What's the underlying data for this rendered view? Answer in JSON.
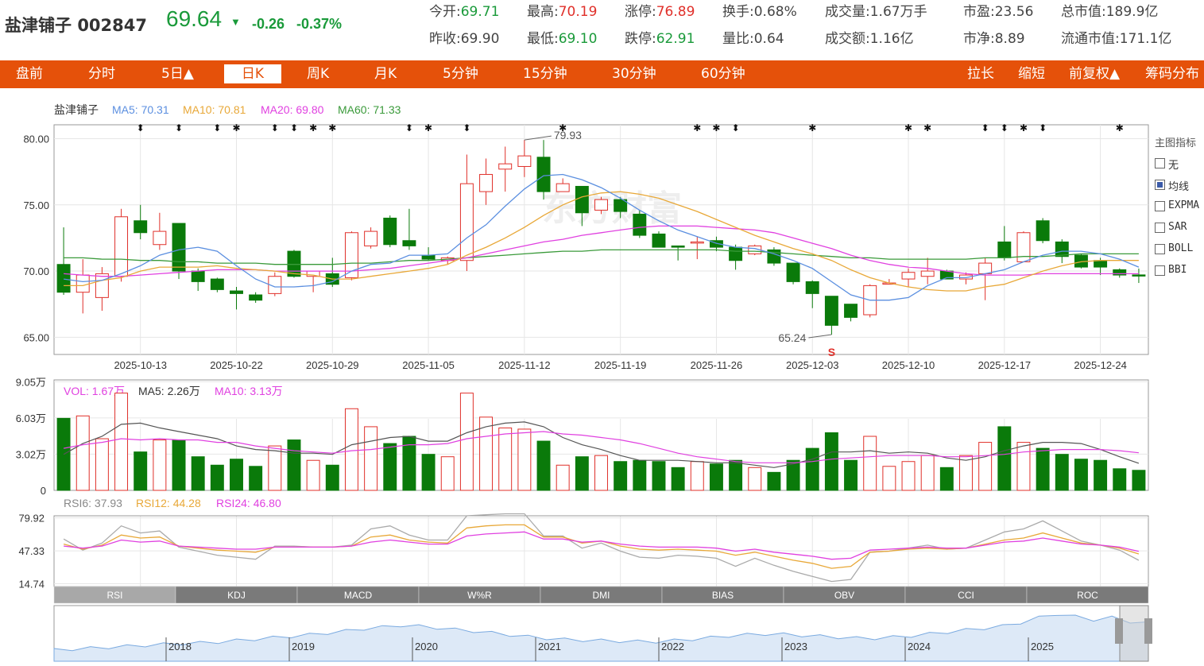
{
  "stock": {
    "name": "盐津铺子",
    "code": "002847",
    "price": "69.64",
    "arrow": "▼",
    "change": "-0.26",
    "change_pct": "-0.37%"
  },
  "quotes": [
    {
      "label": "今开:",
      "value": "69.71",
      "tone": "green"
    },
    {
      "label": "最高:",
      "value": "70.19",
      "tone": "red"
    },
    {
      "label": "涨停:",
      "value": "76.89",
      "tone": "red"
    },
    {
      "label": "换手:",
      "value": "0.68%",
      "tone": "black"
    },
    {
      "label": "成交量:",
      "value": "1.67万手",
      "tone": "black"
    },
    {
      "label": "市盈:",
      "value": "23.56",
      "tone": "black"
    },
    {
      "label": "总市值:",
      "value": "189.9亿",
      "tone": "black"
    },
    {
      "label": "昨收:",
      "value": "69.90",
      "tone": "black"
    },
    {
      "label": "最低:",
      "value": "69.10",
      "tone": "green"
    },
    {
      "label": "跌停:",
      "value": "62.91",
      "tone": "green"
    },
    {
      "label": "量比:",
      "value": "0.64",
      "tone": "black"
    },
    {
      "label": "成交额:",
      "value": "1.16亿",
      "tone": "black"
    },
    {
      "label": "市净:",
      "value": "8.89",
      "tone": "black"
    },
    {
      "label": "流通市值:",
      "value": "171.1亿",
      "tone": "black"
    }
  ],
  "nav": {
    "left": [
      "盘前",
      "分时",
      "5日▲",
      "日K",
      "周K",
      "月K",
      "5分钟",
      "15分钟",
      "30分钟",
      "60分钟"
    ],
    "active": "日K",
    "right": [
      "拉长",
      "缩短",
      "前复权▲",
      "筹码分布"
    ]
  },
  "colors": {
    "up": "#e0302a",
    "down": "#0a7a0a",
    "ma5": "#5b8fe0",
    "ma10": "#e8a838",
    "ma20": "#e040e0",
    "ma60": "#3a9a3a",
    "nav_bg": "#e5510a"
  },
  "kline": {
    "legend": {
      "name": "盐津铺子",
      "ma5": "MA5: 70.31",
      "ma10": "MA10: 70.81",
      "ma20": "MA20: 69.80",
      "ma60": "MA60: 71.33"
    },
    "y_ticks": [
      "80.00",
      "75.00",
      "70.00",
      "65.00"
    ],
    "y_values": [
      80,
      75,
      70,
      65
    ],
    "dates": [
      "2025-10-13",
      "2025-10-22",
      "2025-10-29",
      "2025-11-05",
      "2025-11-12",
      "2025-11-19",
      "2025-11-26",
      "2025-12-03",
      "2025-12-10",
      "2025-12-17",
      "2025-12-24"
    ],
    "high_note": "79.93",
    "low_note": "65.24",
    "low_marker": "S",
    "candles": [
      [
        70.5,
        68.4,
        73.3,
        68.2
      ],
      [
        68.4,
        69.7,
        70.9,
        66.8
      ],
      [
        68.0,
        69.8,
        70.3,
        67.0
      ],
      [
        69.6,
        74.1,
        74.7,
        69.2
      ],
      [
        73.8,
        72.9,
        75.0,
        72.4
      ],
      [
        72.0,
        73.0,
        74.4,
        71.6
      ],
      [
        73.6,
        70.0,
        73.6,
        69.4
      ],
      [
        70.0,
        69.2,
        70.2,
        68.5
      ],
      [
        69.4,
        68.6,
        69.5,
        68.4
      ],
      [
        68.5,
        68.3,
        68.8,
        67.1
      ],
      [
        68.2,
        67.8,
        68.4,
        67.6
      ],
      [
        68.3,
        69.6,
        69.9,
        68.1
      ],
      [
        71.5,
        69.6,
        71.6,
        69.5
      ],
      [
        69.6,
        70.0,
        70.0,
        68.4
      ],
      [
        69.8,
        69.0,
        71.0,
        68.8
      ],
      [
        69.5,
        72.9,
        73.0,
        69.3
      ],
      [
        71.9,
        73.0,
        73.3,
        71.7
      ],
      [
        74.0,
        72.0,
        74.2,
        71.8
      ],
      [
        72.3,
        71.9,
        74.7,
        71.6
      ],
      [
        71.2,
        70.9,
        71.8,
        70.8
      ],
      [
        70.8,
        71.0,
        71.1,
        70.5
      ],
      [
        70.8,
        76.6,
        78.8,
        70.0
      ],
      [
        76.0,
        77.3,
        78.5,
        75.0
      ],
      [
        77.7,
        78.1,
        79.4,
        76.0
      ],
      [
        77.9,
        78.7,
        79.9,
        77.1
      ],
      [
        78.6,
        76.0,
        79.9,
        75.4
      ],
      [
        76.0,
        76.6,
        77.0,
        76.0
      ],
      [
        76.4,
        74.4,
        76.4,
        73.4
      ],
      [
        74.6,
        75.4,
        75.6,
        74.3
      ],
      [
        75.4,
        74.5,
        75.6,
        74.0
      ],
      [
        74.3,
        72.7,
        74.6,
        72.5
      ],
      [
        72.8,
        71.8,
        73.0,
        71.8
      ],
      [
        71.9,
        71.8,
        71.9,
        70.8
      ],
      [
        72.2,
        72.2,
        72.6,
        70.9
      ],
      [
        72.3,
        71.8,
        72.6,
        71.5
      ],
      [
        71.8,
        70.8,
        72.0,
        70.1
      ],
      [
        71.3,
        71.9,
        72.0,
        71.2
      ],
      [
        71.6,
        70.6,
        71.8,
        70.4
      ],
      [
        70.6,
        69.2,
        70.6,
        69.0
      ],
      [
        69.2,
        68.3,
        69.3,
        67.2
      ],
      [
        68.1,
        65.9,
        68.1,
        65.2
      ],
      [
        67.5,
        66.5,
        67.5,
        66.2
      ],
      [
        66.7,
        68.9,
        69.0,
        66.5
      ],
      [
        69.1,
        69.1,
        69.4,
        69.0
      ],
      [
        69.4,
        69.9,
        70.2,
        68.8
      ],
      [
        69.6,
        70.0,
        71.0,
        69.0
      ],
      [
        70.0,
        69.4,
        70.1,
        69.4
      ],
      [
        69.4,
        69.7,
        69.9,
        69.0
      ],
      [
        69.8,
        70.6,
        71.0,
        67.8
      ],
      [
        72.2,
        71.0,
        73.4,
        70.8
      ],
      [
        70.7,
        72.9,
        73.0,
        70.9
      ],
      [
        73.8,
        72.3,
        74.0,
        72.1
      ],
      [
        72.2,
        71.1,
        72.4,
        70.6
      ],
      [
        71.2,
        70.3,
        71.3,
        70.2
      ],
      [
        70.8,
        70.3,
        71.0,
        69.7
      ],
      [
        70.1,
        69.7,
        70.2,
        69.5
      ],
      [
        69.71,
        69.64,
        70.19,
        69.1
      ]
    ],
    "ma5": [
      69.4,
      69.2,
      69.3,
      69.8,
      70.4,
      71.2,
      71.6,
      71.8,
      71.5,
      70.4,
      69.4,
      68.8,
      68.8,
      68.9,
      69.2,
      70.0,
      70.5,
      70.6,
      71.2,
      71.2,
      71.3,
      72.5,
      73.5,
      74.9,
      76.2,
      77.2,
      77.3,
      76.9,
      76.3,
      75.5,
      74.6,
      73.8,
      73.1,
      72.6,
      72.1,
      71.8,
      71.7,
      71.3,
      70.8,
      70.2,
      69.2,
      68.2,
      67.8,
      67.8,
      68.0,
      68.9,
      69.5,
      69.5,
      69.8,
      70.1,
      70.7,
      71.2,
      71.5,
      71.5,
      71.3,
      70.9,
      70.3
    ],
    "ma10": [
      68.9,
      68.9,
      69.3,
      69.5,
      70.0,
      70.3,
      70.3,
      70.3,
      70.4,
      70.2,
      70.1,
      70.0,
      69.8,
      69.7,
      69.4,
      69.4,
      69.6,
      69.8,
      70.0,
      70.2,
      70.5,
      71.2,
      71.8,
      72.5,
      73.3,
      74.2,
      75.0,
      75.6,
      75.9,
      76.0,
      75.8,
      75.5,
      75.0,
      74.5,
      73.9,
      73.3,
      72.7,
      72.2,
      71.7,
      71.3,
      70.8,
      70.1,
      69.5,
      69.1,
      68.8,
      68.6,
      68.5,
      68.5,
      68.8,
      69.0,
      69.5,
      70.0,
      70.4,
      70.7,
      70.8,
      70.8,
      70.8
    ],
    "ma20": [
      69.8,
      69.7,
      69.6,
      69.6,
      69.7,
      69.8,
      69.9,
      70.0,
      70.1,
      70.1,
      70.1,
      70.0,
      70.0,
      70.0,
      70.0,
      70.0,
      70.1,
      70.2,
      70.4,
      70.6,
      70.8,
      71.0,
      71.3,
      71.6,
      71.9,
      72.2,
      72.4,
      72.7,
      72.9,
      73.1,
      73.3,
      73.4,
      73.4,
      73.4,
      73.3,
      73.2,
      73.1,
      72.9,
      72.5,
      72.1,
      71.7,
      71.2,
      70.8,
      70.5,
      70.3,
      70.2,
      70.0,
      69.8,
      69.7,
      69.7,
      69.7,
      69.8,
      69.8,
      69.8,
      69.8,
      69.8,
      69.8
    ],
    "ma60": [
      71.0,
      71.0,
      70.9,
      70.9,
      70.8,
      70.8,
      70.7,
      70.7,
      70.6,
      70.6,
      70.6,
      70.5,
      70.5,
      70.5,
      70.5,
      70.6,
      70.6,
      70.7,
      70.8,
      70.8,
      70.9,
      71.0,
      71.1,
      71.2,
      71.3,
      71.4,
      71.5,
      71.5,
      71.6,
      71.6,
      71.6,
      71.6,
      71.6,
      71.6,
      71.6,
      71.5,
      71.5,
      71.4,
      71.3,
      71.2,
      71.1,
      71.0,
      71.0,
      70.9,
      70.9,
      70.9,
      70.9,
      70.9,
      71.0,
      71.0,
      71.1,
      71.1,
      71.2,
      71.3,
      71.3,
      71.3,
      71.3
    ],
    "event_markers": [
      {
        "index": 4,
        "symbol": "⬍"
      },
      {
        "index": 6,
        "symbol": "⬍"
      },
      {
        "index": 8,
        "symbol": "⬍"
      },
      {
        "index": 9,
        "symbol": "✱"
      },
      {
        "index": 11,
        "symbol": "⬍"
      },
      {
        "index": 12,
        "symbol": "⬍"
      },
      {
        "index": 13,
        "symbol": "✱"
      },
      {
        "index": 14,
        "symbol": "✱"
      },
      {
        "index": 18,
        "symbol": "⬍"
      },
      {
        "index": 19,
        "symbol": "✱"
      },
      {
        "index": 21,
        "symbol": "⬍"
      },
      {
        "index": 26,
        "symbol": "✱"
      },
      {
        "index": 33,
        "symbol": "✱"
      },
      {
        "index": 34,
        "symbol": "✱"
      },
      {
        "index": 35,
        "symbol": "⬍"
      },
      {
        "index": 39,
        "symbol": "✱"
      },
      {
        "index": 44,
        "symbol": "✱"
      },
      {
        "index": 45,
        "symbol": "✱"
      },
      {
        "index": 48,
        "symbol": "⬍"
      },
      {
        "index": 49,
        "symbol": "⬍"
      },
      {
        "index": 50,
        "symbol": "✱"
      },
      {
        "index": 51,
        "symbol": "⬍"
      },
      {
        "index": 55,
        "symbol": "✱"
      }
    ],
    "watermark": "东方财富"
  },
  "indicators_panel": {
    "title": "主图指标",
    "options": [
      {
        "label": "无",
        "checked": false
      },
      {
        "label": "均线",
        "checked": true
      },
      {
        "label": "EXPMA",
        "checked": false
      },
      {
        "label": "SAR",
        "checked": false
      },
      {
        "label": "BOLL",
        "checked": false
      },
      {
        "label": "BBI",
        "checked": false
      }
    ]
  },
  "volume": {
    "legend": {
      "vol": "VOL: 1.67万",
      "ma5": "MA5: 2.26万",
      "ma10": "MA10: 3.13万"
    },
    "y_ticks": [
      "9.05万",
      "6.03万",
      "3.02万",
      "0"
    ],
    "y_values": [
      9.05,
      6.03,
      3.02,
      0
    ],
    "bars": [
      6.0,
      6.2,
      4.3,
      8.1,
      3.2,
      4.2,
      4.2,
      2.8,
      2.1,
      2.6,
      2.0,
      3.7,
      4.2,
      2.5,
      2.1,
      6.8,
      5.3,
      3.9,
      4.5,
      3.0,
      2.8,
      8.1,
      6.1,
      5.2,
      5.1,
      4.1,
      2.1,
      2.8,
      2.9,
      2.4,
      2.5,
      2.4,
      1.9,
      2.4,
      2.2,
      2.5,
      1.9,
      1.5,
      2.5,
      3.5,
      4.8,
      2.5,
      4.5,
      2.0,
      2.4,
      2.9,
      1.9,
      2.9,
      4.0,
      5.3,
      4.0,
      3.5,
      3.0,
      2.6,
      2.5,
      1.8,
      1.67
    ],
    "ma5": [
      3.0,
      3.9,
      4.5,
      5.5,
      5.6,
      5.2,
      4.9,
      4.6,
      4.3,
      3.7,
      3.4,
      3.3,
      3.1,
      3.1,
      3.0,
      3.8,
      4.1,
      4.4,
      4.5,
      4.1,
      4.1,
      4.8,
      5.3,
      5.6,
      5.7,
      5.3,
      4.4,
      3.8,
      3.4,
      2.9,
      2.5,
      2.5,
      2.5,
      2.4,
      2.3,
      2.3,
      2.1,
      1.9,
      2.2,
      2.6,
      3.2,
      3.2,
      3.3,
      3.1,
      3.2,
      3.1,
      2.7,
      2.5,
      2.8,
      3.3,
      3.7,
      4.0,
      4.0,
      3.9,
      3.4,
      2.8,
      2.26
    ],
    "ma10": [
      3.5,
      3.8,
      4.0,
      4.3,
      4.2,
      4.3,
      4.2,
      4.2,
      4.0,
      4.0,
      3.7,
      3.5,
      3.3,
      3.2,
      3.1,
      3.3,
      3.4,
      3.6,
      3.8,
      3.8,
      3.9,
      4.3,
      4.5,
      4.7,
      4.8,
      4.9,
      4.7,
      4.6,
      4.4,
      4.2,
      3.9,
      3.5,
      3.1,
      2.8,
      2.6,
      2.4,
      2.3,
      2.3,
      2.3,
      2.4,
      2.6,
      2.7,
      2.8,
      2.9,
      2.9,
      2.9,
      2.8,
      2.8,
      2.9,
      3.0,
      3.2,
      3.3,
      3.4,
      3.4,
      3.4,
      3.3,
      3.13
    ]
  },
  "rsi": {
    "legend": {
      "rsi6": "RSI6: 37.93",
      "rsi12": "RSI12: 44.28",
      "rsi24": "RSI24: 46.80"
    },
    "y_ticks": [
      "79.92",
      "47.33",
      "14.74"
    ],
    "y_values": [
      79.92,
      47.33,
      14.74
    ],
    "rsi6": [
      59,
      48,
      55,
      72,
      65,
      67,
      51,
      47,
      43,
      41,
      39,
      52,
      52,
      51,
      51,
      53,
      69,
      72,
      63,
      58,
      58,
      82,
      83,
      84,
      84,
      62,
      62,
      50,
      55,
      47,
      41,
      40,
      43,
      42,
      40,
      32,
      40,
      33,
      27,
      22,
      17,
      19,
      46,
      47,
      50,
      53,
      49,
      50,
      58,
      66,
      69,
      77,
      67,
      57,
      53,
      48,
      37.93
    ],
    "rsi12": [
      54,
      49,
      53,
      63,
      60,
      61,
      52,
      50,
      48,
      47,
      46,
      51,
      51,
      51,
      51,
      52,
      61,
      63,
      58,
      56,
      55,
      70,
      72,
      73,
      73,
      61,
      61,
      55,
      57,
      52,
      49,
      48,
      49,
      48,
      47,
      43,
      46,
      42,
      38,
      35,
      30,
      32,
      46,
      47,
      49,
      50,
      49,
      50,
      54,
      58,
      60,
      65,
      60,
      55,
      53,
      50,
      44.28
    ],
    "rsi24": [
      52,
      50,
      52,
      58,
      56,
      57,
      52,
      51,
      50,
      49,
      49,
      51,
      51,
      51,
      51,
      52,
      56,
      58,
      56,
      54,
      54,
      62,
      64,
      65,
      66,
      59,
      59,
      56,
      57,
      54,
      52,
      51,
      51,
      51,
      50,
      47,
      49,
      46,
      44,
      42,
      39,
      40,
      48,
      49,
      50,
      51,
      50,
      50,
      53,
      56,
      57,
      60,
      57,
      54,
      53,
      51,
      46.8
    ]
  },
  "tabs": [
    "RSI",
    "KDJ",
    "MACD",
    "W%R",
    "DMI",
    "BIAS",
    "OBV",
    "CCI",
    "ROC"
  ],
  "active_tab": "RSI",
  "overview": {
    "years": [
      "2018",
      "2019",
      "2020",
      "2021",
      "2022",
      "2023",
      "2024",
      "2025"
    ],
    "series": [
      10,
      12,
      14,
      16,
      18,
      20,
      22,
      24,
      25,
      27,
      30,
      33,
      36,
      39,
      42,
      46,
      50,
      55,
      58,
      62,
      60,
      57,
      53,
      50,
      46,
      42,
      38,
      35,
      32,
      31,
      30,
      29,
      28,
      28,
      30,
      33,
      36,
      40,
      42,
      44,
      43,
      41,
      39,
      37,
      35,
      35,
      37,
      40,
      44,
      48,
      52,
      56,
      60,
      68,
      78,
      86,
      80,
      74,
      78,
      70,
      66
    ]
  }
}
